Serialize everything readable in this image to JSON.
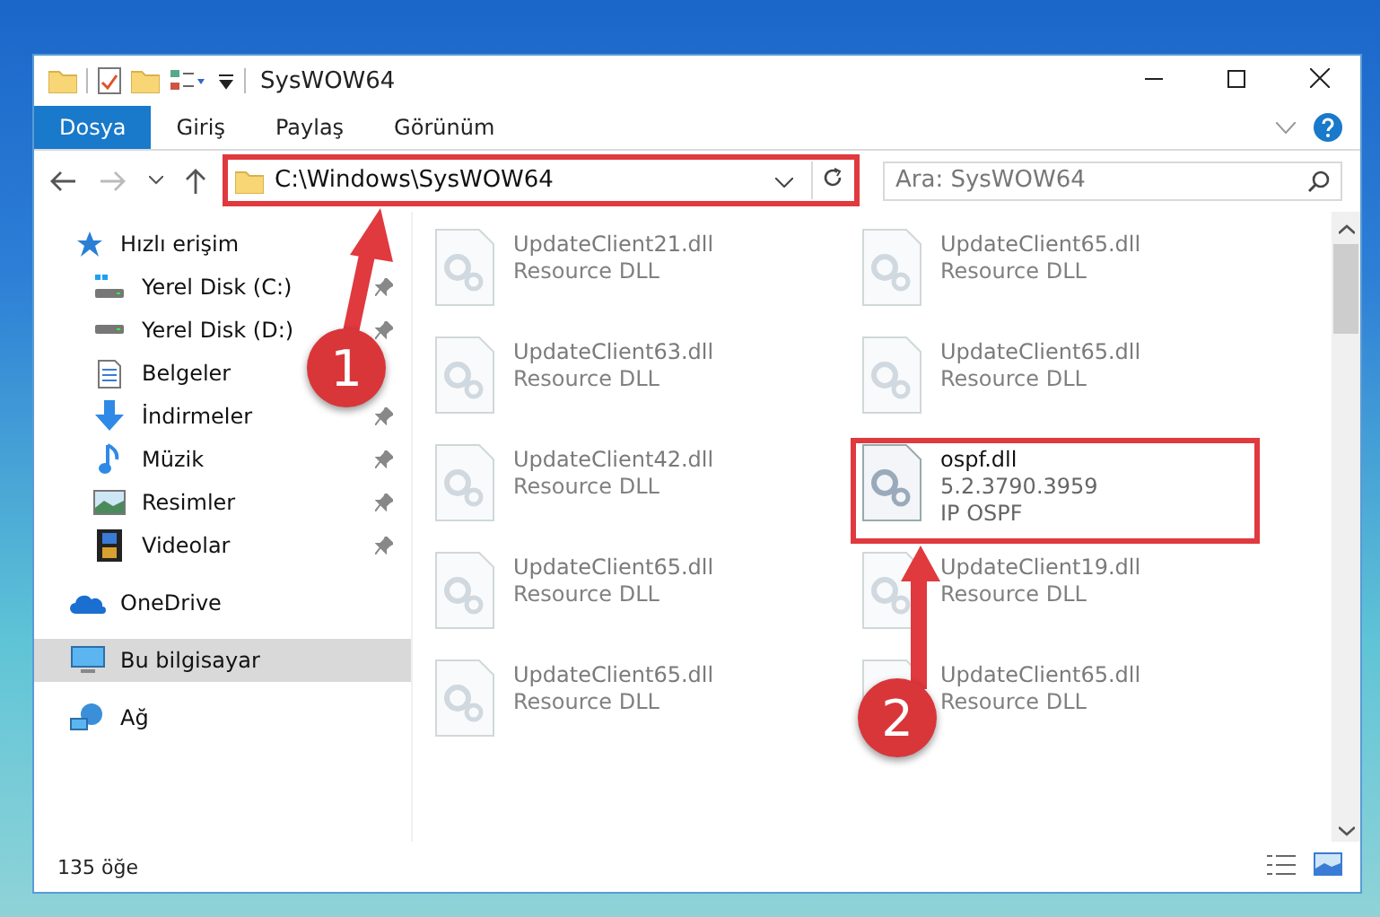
{
  "window": {
    "title": "SysWOW64"
  },
  "ribbon_tabs": [
    {
      "label": "Dosya",
      "kind": "file",
      "selected": true
    },
    {
      "label": "Giriş",
      "kind": "tab",
      "selected": false
    },
    {
      "label": "Paylaş",
      "kind": "tab",
      "selected": false
    },
    {
      "label": "Görünüm",
      "kind": "tab",
      "selected": false
    }
  ],
  "address": {
    "path": "C:\\Windows\\SysWOW64"
  },
  "search": {
    "placeholder": "Ara: SysWOW64"
  },
  "sidebar": {
    "items": [
      {
        "label": "Hızlı erişim",
        "kind": "star",
        "selected": false,
        "pinned": false,
        "children": [
          {
            "label": "Yerel Disk (C:)",
            "kind": "windrive",
            "selected": false,
            "pinned": true
          },
          {
            "label": "Yerel Disk (D:)",
            "kind": "drive",
            "selected": false,
            "pinned": true
          },
          {
            "label": "Belgeler",
            "kind": "document",
            "selected": false,
            "pinned": false
          },
          {
            "label": "İndirmeler",
            "kind": "download",
            "selected": false,
            "pinned": true
          },
          {
            "label": "Müzik",
            "kind": "music",
            "selected": false,
            "pinned": true
          },
          {
            "label": "Resimler",
            "kind": "picture",
            "selected": false,
            "pinned": true
          },
          {
            "label": "Videolar",
            "kind": "video",
            "selected": false,
            "pinned": true
          }
        ]
      },
      {
        "label": "OneDrive",
        "kind": "cloud",
        "selected": false,
        "pinned": false
      },
      {
        "label": "Bu bilgisayar",
        "kind": "computer",
        "selected": true,
        "pinned": false
      },
      {
        "label": "Ağ",
        "kind": "network",
        "selected": false,
        "pinned": false
      }
    ]
  },
  "files": [
    {
      "name": "UpdateClient21.dll",
      "details": [
        "Resource DLL"
      ],
      "blurred": true
    },
    {
      "name": "UpdateClient65.dll",
      "details": [
        "Resource DLL"
      ],
      "blurred": true
    },
    {
      "name": "UpdateClient63.dll",
      "details": [
        "Resource DLL"
      ],
      "blurred": true
    },
    {
      "name": "UpdateClient65.dll",
      "details": [
        "Resource DLL"
      ],
      "blurred": true
    },
    {
      "name": "UpdateClient42.dll",
      "details": [
        "Resource DLL"
      ],
      "blurred": true
    },
    {
      "name": "ospf.dll",
      "details": [
        "5.2.3790.3959",
        "IP OSPF"
      ],
      "blurred": false
    },
    {
      "name": "UpdateClient65.dll",
      "details": [
        "Resource DLL"
      ],
      "blurred": true
    },
    {
      "name": "UpdateClient19.dll",
      "details": [
        "Resource DLL"
      ],
      "blurred": true
    },
    {
      "name": "UpdateClient65.dll",
      "details": [
        "Resource DLL"
      ],
      "blurred": true
    },
    {
      "name": "UpdateClient65.dll",
      "details": [
        "Resource DLL"
      ],
      "blurred": true
    }
  ],
  "status_bar": {
    "item_count": "135 öğe"
  },
  "callouts": [
    {
      "number": "1"
    },
    {
      "number": "2"
    }
  ]
}
